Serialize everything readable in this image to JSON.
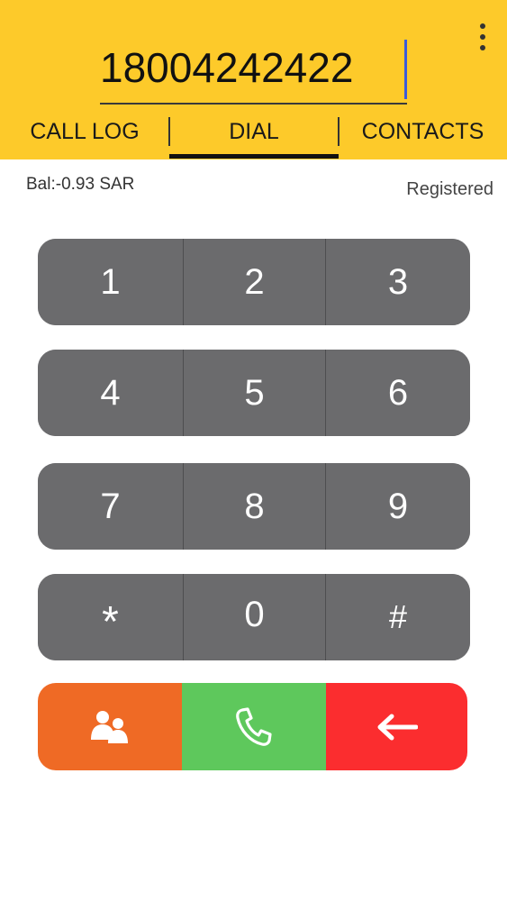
{
  "dialer": {
    "number": "18004242422"
  },
  "tabs": [
    {
      "label": "CALL LOG",
      "active": false
    },
    {
      "label": "DIAL",
      "active": true
    },
    {
      "label": "CONTACTS",
      "active": false
    }
  ],
  "status": {
    "balance": "Bal:-0.93 SAR",
    "registration": "Registered"
  },
  "keypad": {
    "rows": [
      [
        "1",
        "2",
        "3"
      ],
      [
        "4",
        "5",
        "6"
      ],
      [
        "7",
        "8",
        "9"
      ],
      [
        "*",
        "0",
        "#"
      ]
    ]
  },
  "actions": {
    "contacts_icon": "contacts-icon",
    "call_icon": "phone-icon",
    "backspace_icon": "backspace-arrow-icon"
  },
  "colors": {
    "header_bg": "#fdca2a",
    "key_bg": "#6b6b6d",
    "contacts_btn": "#ef6a25",
    "call_btn": "#5ec85c",
    "backspace_btn": "#fb2d2f",
    "caret": "#3b5bdb"
  }
}
